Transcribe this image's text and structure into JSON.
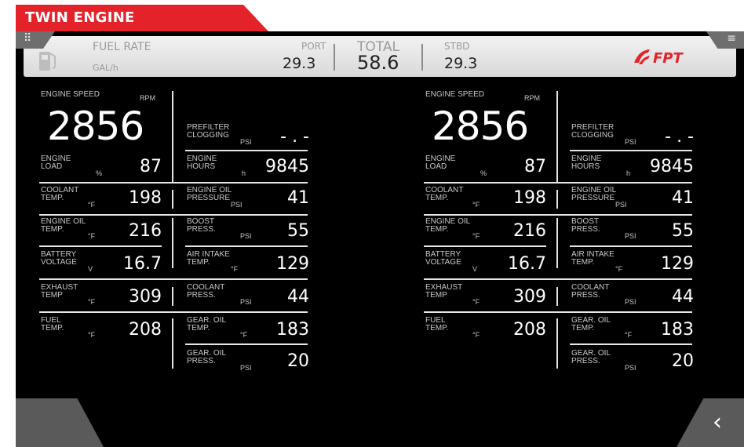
{
  "title": "TWIN ENGINE",
  "colors": {
    "brand_red": "#e3222a",
    "panel_bg": "#000000",
    "header_bg": "#e6e6e6"
  },
  "header": {
    "menu_left_icon": "grid-icon",
    "menu_right_icon": "hamburger-menu-icon",
    "fuel_icon": "fuel-pump-icon",
    "fuel_rate_label": "FUEL RATE",
    "fuel_unit": "GAL/h",
    "port_label": "PORT",
    "port_value": "29.3",
    "total_label": "TOTAL",
    "total_value": "58.6",
    "stbd_label": "STBD",
    "stbd_value": "29.3",
    "logo_text": "FPT"
  },
  "engines": [
    {
      "speed_label": "ENGINE SPEED",
      "speed_unit": "RPM",
      "speed_value": "2856",
      "prefilter_l1": "PREFILTER",
      "prefilter_l2": "CLOGGING",
      "prefilter_unit": "PSI",
      "prefilter_value": "- . -",
      "load_l1": "ENGINE",
      "load_l2": "LOAD",
      "load_unit": "%",
      "load_value": "87",
      "hours_l1": "ENGINE",
      "hours_l2": "HOURS",
      "hours_unit": "h",
      "hours_value": "9845",
      "coolant_l1": "COOLANT",
      "coolant_l2": "TEMP.",
      "coolant_unit": "°F",
      "coolant_value": "198",
      "oilp_l1": "ENGINE OIL",
      "oilp_l2": "PRESSURE",
      "oilp_unit": "PSI",
      "oilp_value": "41",
      "oilt_l1": "ENGINE OIL",
      "oilt_l2": "TEMP.",
      "oilt_unit": "°F",
      "oilt_value": "216",
      "boost_l1": "BOOST",
      "boost_l2": "PRESS.",
      "boost_unit": "PSI",
      "boost_value": "55",
      "batt_l1": "BATTERY",
      "batt_l2": "VOLTAGE",
      "batt_unit": "V",
      "batt_value": "16.7",
      "air_l1": "AIR INTAKE",
      "air_l2": "TEMP.",
      "air_unit": "°F",
      "air_value": "129",
      "exh_l1": "EXHAUST",
      "exh_l2": "TEMP",
      "exh_unit": "°F",
      "exh_value": "309",
      "cp_l1": "COOLANT",
      "cp_l2": "PRESS.",
      "cp_unit": "PSI",
      "cp_value": "44",
      "fuel_l1": "FUEL",
      "fuel_l2": "TEMP.",
      "fuel_unit": "°F",
      "fuel_value": "208",
      "got_l1": "GEAR. OIL",
      "got_l2": "TEMP.",
      "got_unit": "°F",
      "got_value": "183",
      "gop_l1": "GEAR. OIL",
      "gop_l2": "PRESS.",
      "gop_unit": "PSI",
      "gop_value": "20"
    },
    {
      "speed_label": "ENGINE SPEED",
      "speed_unit": "RPM",
      "speed_value": "2856",
      "prefilter_l1": "PREFILTER",
      "prefilter_l2": "CLOGGING",
      "prefilter_unit": "PSI",
      "prefilter_value": "- . -",
      "load_l1": "ENGINE",
      "load_l2": "LOAD",
      "load_unit": "%",
      "load_value": "87",
      "hours_l1": "ENGINE",
      "hours_l2": "HOURS",
      "hours_unit": "h",
      "hours_value": "9845",
      "coolant_l1": "COOLANT",
      "coolant_l2": "TEMP.",
      "coolant_unit": "°F",
      "coolant_value": "198",
      "oilp_l1": "ENGINE OIL",
      "oilp_l2": "PRESSURE",
      "oilp_unit": "PSI",
      "oilp_value": "41",
      "oilt_l1": "ENGINE OIL",
      "oilt_l2": "TEMP.",
      "oilt_unit": "°F",
      "oilt_value": "216",
      "boost_l1": "BOOST",
      "boost_l2": "PRESS.",
      "boost_unit": "PSI",
      "boost_value": "55",
      "batt_l1": "BATTERY",
      "batt_l2": "VOLTAGE",
      "batt_unit": "V",
      "batt_value": "16.7",
      "air_l1": "AIR INTAKE",
      "air_l2": "TEMP.",
      "air_unit": "°F",
      "air_value": "129",
      "exh_l1": "EXHAUST",
      "exh_l2": "TEMP",
      "exh_unit": "°F",
      "exh_value": "309",
      "cp_l1": "COOLANT",
      "cp_l2": "PRESS.",
      "cp_unit": "PSI",
      "cp_value": "44",
      "fuel_l1": "FUEL",
      "fuel_l2": "TEMP.",
      "fuel_unit": "°F",
      "fuel_value": "208",
      "got_l1": "GEAR. OIL",
      "got_l2": "TEMP.",
      "got_unit": "°F",
      "got_value": "183",
      "gop_l1": "GEAR. OIL",
      "gop_l2": "PRESS.",
      "gop_unit": "PSI",
      "gop_value": "20"
    }
  ],
  "footer": {
    "back_icon": "chevron-left-icon",
    "back_glyph": "‹"
  }
}
